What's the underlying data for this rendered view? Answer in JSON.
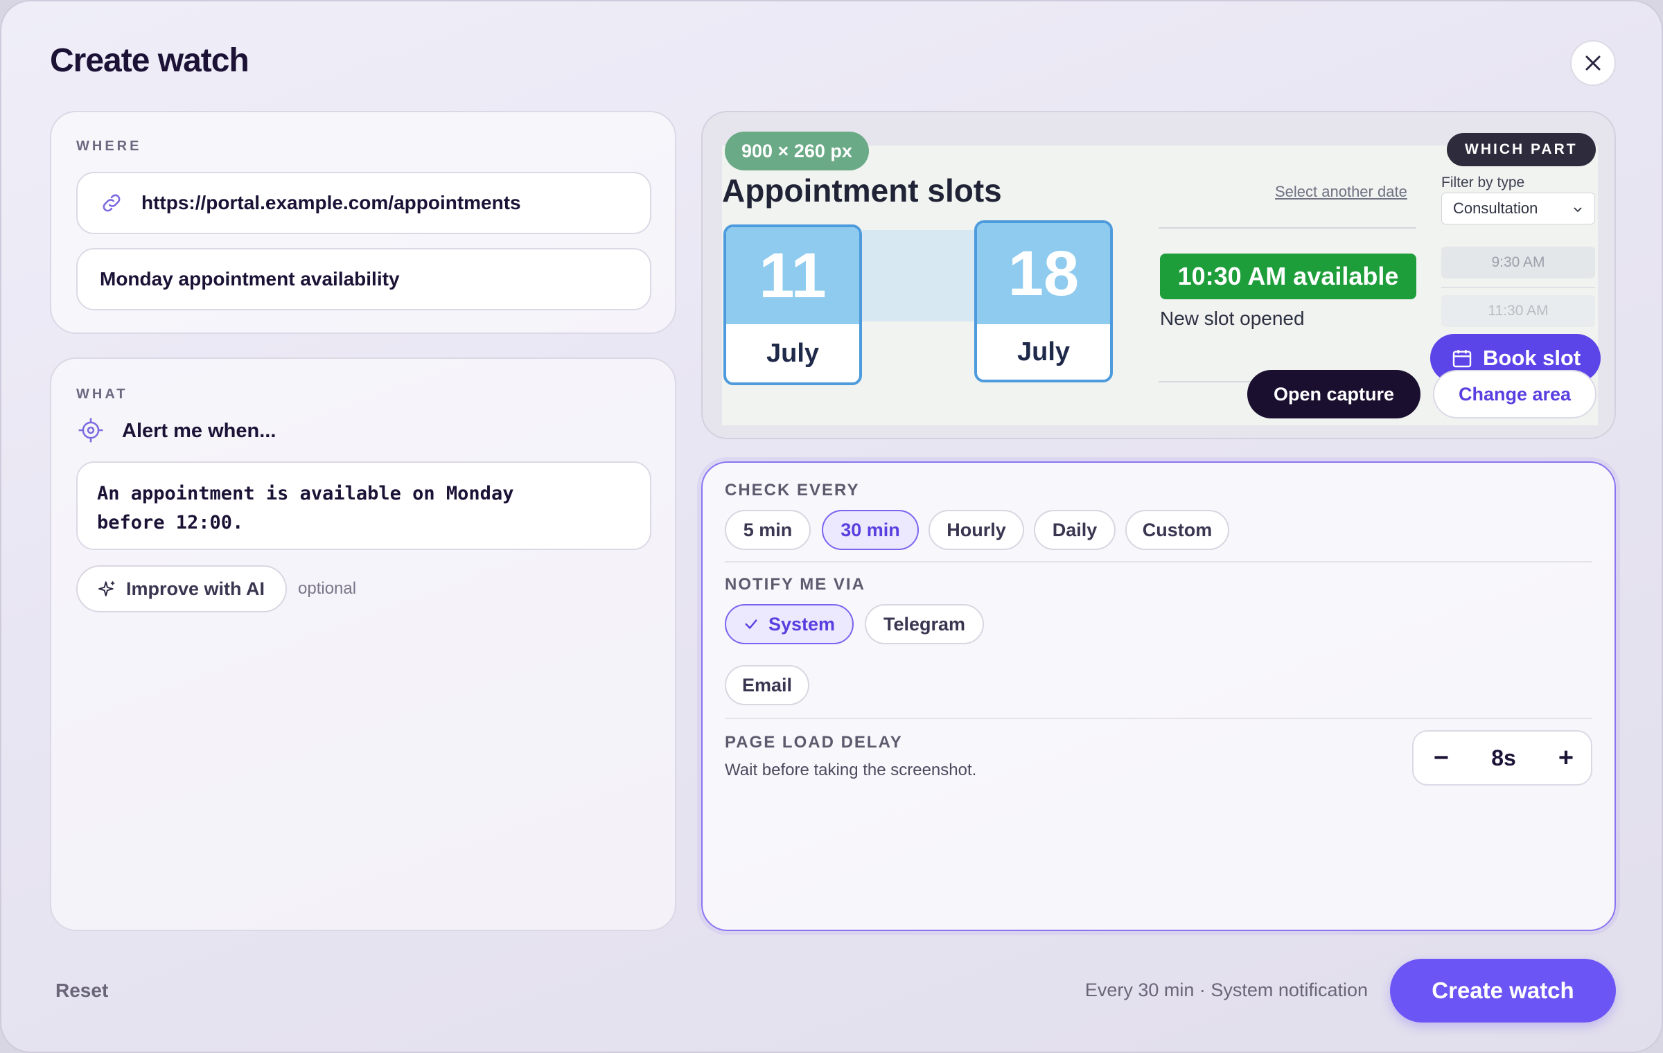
{
  "dialog": {
    "title": "Create watch"
  },
  "where": {
    "label": "WHERE",
    "url": "https://portal.example.com/appointments",
    "name": "Monday appointment availability"
  },
  "what": {
    "label": "WHAT",
    "alert_label": "Alert me when...",
    "condition": "An appointment is available on Monday before 12:00.",
    "improve_label": "Improve with AI",
    "optional_label": "optional"
  },
  "preview": {
    "size_badge": "900 × 260 px",
    "which_part": "WHICH PART",
    "heading": "Appointment slots",
    "select_date": "Select another date",
    "filter_label": "Filter by type",
    "filter_value": "Consultation",
    "dates": [
      {
        "day": "11",
        "month": "July"
      },
      {
        "day": "18",
        "month": "July"
      }
    ],
    "available_badge": "10:30 AM available",
    "slot_opened": "New slot opened",
    "time_slots": [
      "9:30 AM",
      "11:30 AM"
    ],
    "book_slot": "Book slot",
    "open_capture": "Open capture",
    "change_area": "Change area"
  },
  "check_every": {
    "label": "CHECK EVERY",
    "options": [
      "5 min",
      "30 min",
      "Hourly",
      "Daily",
      "Custom"
    ],
    "selected": "30 min"
  },
  "notify": {
    "label": "NOTIFY ME VIA",
    "options": [
      "System",
      "Telegram",
      "Email"
    ],
    "selected": "System"
  },
  "delay": {
    "label": "PAGE LOAD DELAY",
    "description": "Wait before taking the screenshot.",
    "value": "8s",
    "minus": "−",
    "plus": "+"
  },
  "footer": {
    "reset": "Reset",
    "summary": "Every 30 min · System notification",
    "create": "Create watch"
  },
  "colors": {
    "accent": "#6c55f5",
    "dark": "#1b0f30",
    "available_green": "#1e9e3a",
    "size_badge": "#6aaa86"
  }
}
